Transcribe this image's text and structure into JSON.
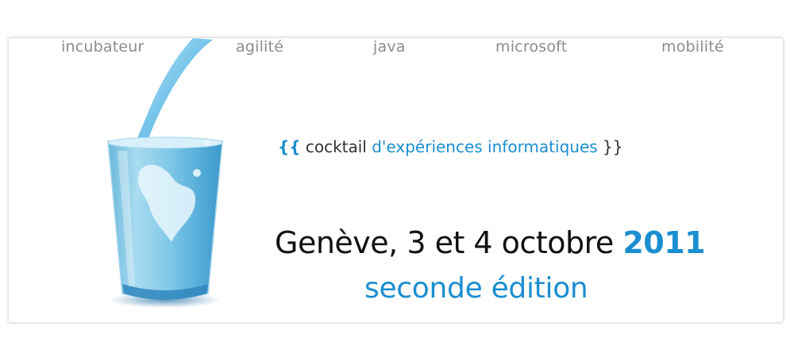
{
  "nav": {
    "items": [
      {
        "label": "incubateur"
      },
      {
        "label": "agilité"
      },
      {
        "label": "java"
      },
      {
        "label": "microsoft"
      },
      {
        "label": "mobilité"
      }
    ]
  },
  "hero": {
    "tagline": {
      "open_brace": "{{",
      "cocktail": "cocktail",
      "rest": "d'expériences informatiques",
      "close_brace": "}}"
    },
    "date_text": "Genève, 3 et 4 octobre",
    "year": "2011",
    "edition": "seconde édition",
    "illustration_icon": "milk-glass-icon"
  },
  "colors": {
    "accent": "#1b8ed0",
    "nav_text": "#8c8c8c",
    "heading_text": "#111111"
  }
}
